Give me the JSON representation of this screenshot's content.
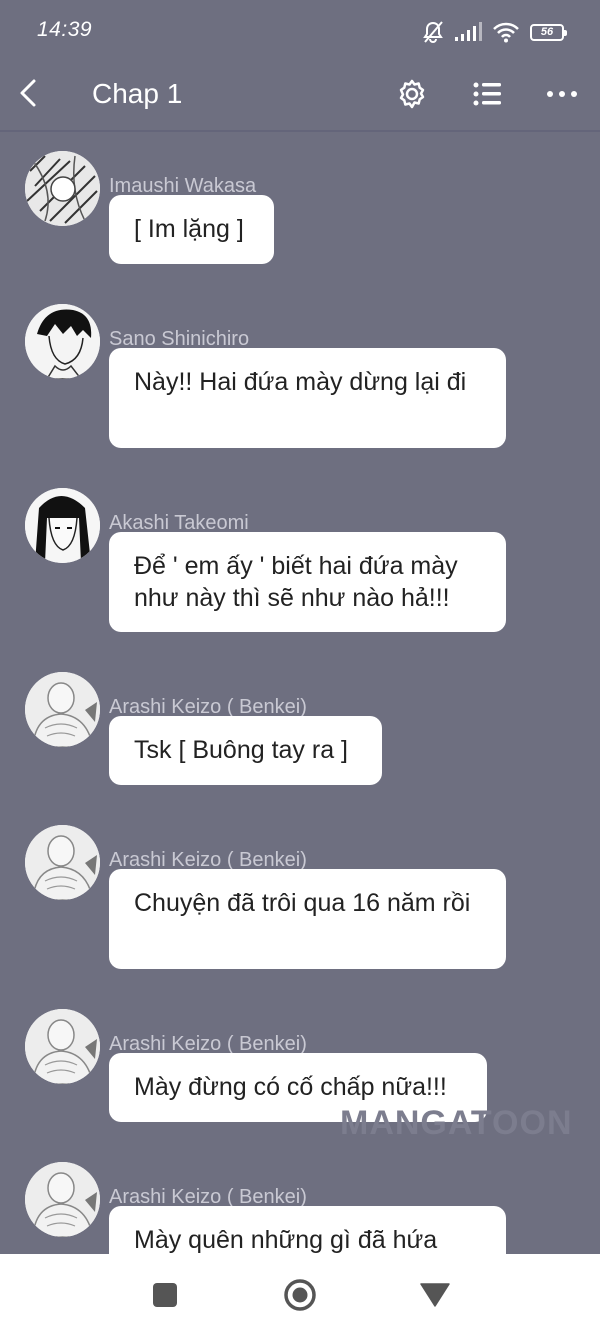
{
  "status_bar": {
    "time": "14:39",
    "battery": "56",
    "icons": [
      "bell-mute-icon",
      "signal-icon",
      "wifi-icon",
      "battery-icon"
    ]
  },
  "header": {
    "title": "Chap 1",
    "icons": [
      "back-chevron-icon",
      "gear-icon",
      "list-icon",
      "more-dots-icon"
    ]
  },
  "messages": [
    {
      "sender": "Imaushi Wakasa",
      "text": "[ Im lặng ]",
      "avatar": "wakasa-avatar"
    },
    {
      "sender": "Sano Shinichiro",
      "text": "Này!! Hai đứa mày dừng lại đi",
      "avatar": "shinichiro-avatar"
    },
    {
      "sender": "Akashi Takeomi",
      "text": "Để ' em ấy ' biết hai đứa mày như này thì sẽ như nào hả!!!",
      "avatar": "takeomi-avatar"
    },
    {
      "sender": "Arashi Keizo ( Benkei)",
      "text": "Tsk [ Buông tay ra ]",
      "avatar": "benkei-avatar"
    },
    {
      "sender": "Arashi Keizo ( Benkei)",
      "text": "Chuyện đã trôi qua 16 năm rồi",
      "avatar": "benkei-avatar"
    },
    {
      "sender": "Arashi Keizo ( Benkei)",
      "text": "Mày đừng có cố chấp nữa!!!",
      "avatar": "benkei-avatar"
    },
    {
      "sender": "Arashi Keizo ( Benkei)",
      "text": "Mày quên những gì đã hứa",
      "avatar": "benkei-avatar"
    }
  ],
  "watermark": "MANGATOON",
  "nav_bar": {
    "icons": [
      "recents-square-icon",
      "home-circle-icon",
      "back-triangle-icon"
    ]
  },
  "colors": {
    "background": "#6e6f80",
    "bubble": "#ffffff",
    "sender_text": "#c9c9d3",
    "nav_bar": "#ffffff"
  }
}
